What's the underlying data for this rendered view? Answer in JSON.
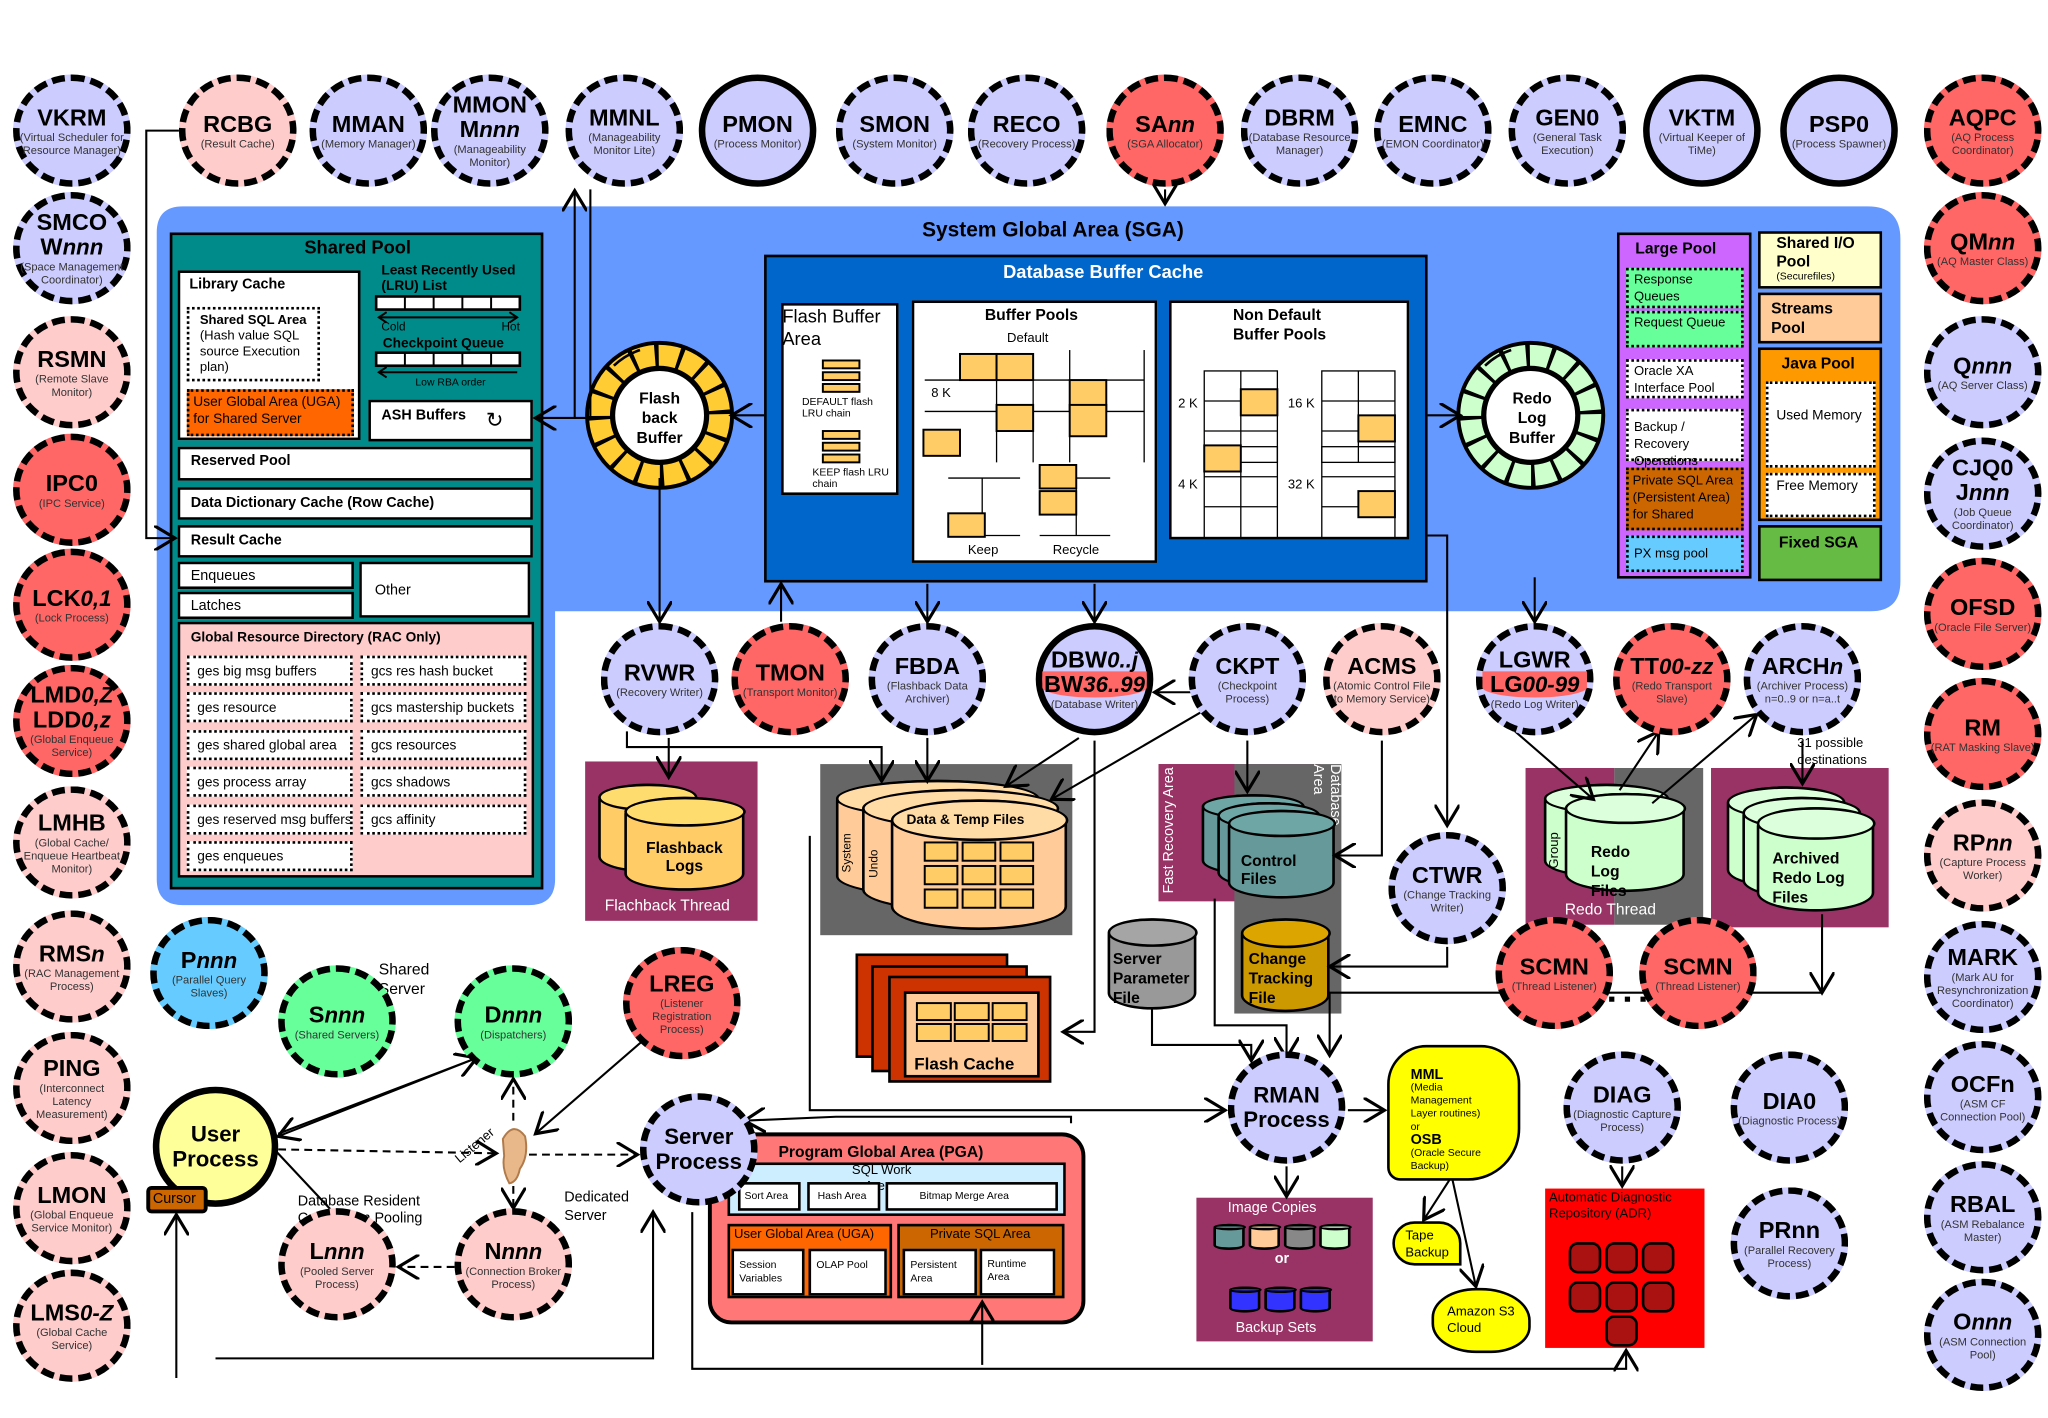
{
  "colors": {
    "lavender": "#ccccff",
    "pink": "#ffcccc",
    "red": "#ff6666",
    "green": "#66ff99",
    "blue": "#66ccff",
    "yellow": "#ffff99",
    "sga_blue": "#6699ff",
    "buffer_cache_blue": "#0066cc",
    "shared_pool_teal": "#008b8b",
    "large_pool_purple": "#cc66ff",
    "storage_purple": "#993366"
  },
  "processes": [
    {
      "id": "vkrm",
      "name": "VKRM",
      "desc": "(Virtual Scheduler for Resource Manager)",
      "fill": "lavender"
    },
    {
      "id": "rcbg",
      "name": "RCBG",
      "desc": "(Result Cache)",
      "fill": "pink"
    },
    {
      "id": "mman",
      "name": "MMAN",
      "desc": "(Memory Manager)",
      "fill": "lavender"
    },
    {
      "id": "mmon",
      "name": "MMON",
      "name2": "M",
      "name2_italic": "nnn",
      "desc": "(Manageability Monitor)",
      "fill": "lavender"
    },
    {
      "id": "mmnl",
      "name": "MMNL",
      "desc": "(Manageability Monitor Lite)",
      "fill": "lavender"
    },
    {
      "id": "pmon",
      "name": "PMON",
      "desc": "(Process Monitor)",
      "fill": "lavender",
      "solid": true
    },
    {
      "id": "smon",
      "name": "SMON",
      "desc": "(System Monitor)",
      "fill": "lavender"
    },
    {
      "id": "reco",
      "name": "RECO",
      "desc": "(Recovery Process)",
      "fill": "lavender"
    },
    {
      "id": "sann",
      "name": "SA",
      "name_italic": "nn",
      "desc": "(SGA Allocator)",
      "fill": "red"
    },
    {
      "id": "dbrm",
      "name": "DBRM",
      "desc": "(Database Resource Manager)",
      "fill": "lavender"
    },
    {
      "id": "emnc",
      "name": "EMNC",
      "desc": "(EMON Coordinator)",
      "fill": "lavender"
    },
    {
      "id": "gen0",
      "name": "GEN0",
      "desc": "(General Task Execution)",
      "fill": "lavender"
    },
    {
      "id": "vktm",
      "name": "VKTM",
      "desc": "(Virtual Keeper of TiMe)",
      "fill": "lavender",
      "solid": true
    },
    {
      "id": "psp0",
      "name": "PSP0",
      "desc": "(Process Spawner)",
      "fill": "lavender",
      "solid": true
    },
    {
      "id": "aqpc",
      "name": "AQPC",
      "desc": "(AQ Process Coordinator)",
      "fill": "red"
    },
    {
      "id": "smco",
      "name": "SMCO",
      "name2": "W",
      "name2_italic": "nnn",
      "desc": "(Space Management Coordinator)",
      "fill": "lavender"
    },
    {
      "id": "rsmn",
      "name": "RSMN",
      "desc": "(Remote Slave Monitor)",
      "fill": "pink"
    },
    {
      "id": "ipc0",
      "name": "IPC0",
      "desc": "(IPC Service)",
      "fill": "red"
    },
    {
      "id": "lck",
      "name": "LCK",
      "name_italic": "0,1",
      "desc": "(Lock Process)",
      "fill": "red"
    },
    {
      "id": "lmd",
      "name": "LMD",
      "name_italic": "0,Z",
      "name2": "LDD",
      "name2_italic": "0,z",
      "desc": "(Global Enqueue Service)",
      "fill": "red"
    },
    {
      "id": "lmhb",
      "name": "LMHB",
      "desc": "(Global Cache/ Enqueue Heartbeat Monitor)",
      "fill": "pink"
    },
    {
      "id": "rmsn",
      "name": "RMS",
      "name_italic": "n",
      "desc": "(RAC Management Process)",
      "fill": "pink"
    },
    {
      "id": "ping",
      "name": "PING",
      "desc": "(Interconnect Latency Measurement)",
      "fill": "pink"
    },
    {
      "id": "lmon",
      "name": "LMON",
      "desc": "(Global Enqueue Service Monitor)",
      "fill": "pink"
    },
    {
      "id": "lms",
      "name": "LMS",
      "name_italic": "0-Z",
      "desc": "(Global Cache Service)",
      "fill": "pink"
    },
    {
      "id": "qmnn",
      "name": "QM",
      "name_italic": "nn",
      "desc": "(AQ Master Class)",
      "fill": "red"
    },
    {
      "id": "qnnn",
      "name": "Q",
      "name_italic": "nnn",
      "desc": "(AQ Server Class)",
      "fill": "lavender"
    },
    {
      "id": "cjq0",
      "name": "CJQ0",
      "name2": "J",
      "name2_italic": "nnn",
      "desc": "(Job Queue Coordinator)",
      "fill": "lavender"
    },
    {
      "id": "ofsd",
      "name": "OFSD",
      "desc": "(Oracle File Server)",
      "fill": "red"
    },
    {
      "id": "rm",
      "name": "RM",
      "desc": "(RAT Masking Slave)",
      "fill": "red"
    },
    {
      "id": "rpnn",
      "name": "RP",
      "name_italic": "nn",
      "desc": "(Capture Process Worker)",
      "fill": "pink"
    },
    {
      "id": "mark",
      "name": "MARK",
      "desc": "(Mark AU for Resynchronization Coordinator)",
      "fill": "lavender"
    },
    {
      "id": "ocfn",
      "name": "OCFn",
      "desc": "(ASM CF Connection Pool)",
      "fill": "lavender"
    },
    {
      "id": "rbal",
      "name": "RBAL",
      "desc": "(ASM Rebalance Master)",
      "fill": "lavender"
    },
    {
      "id": "onnn",
      "name": "O",
      "name_italic": "nnn",
      "desc": "(ASM Connection Pool)",
      "fill": "lavender"
    },
    {
      "id": "rvwr",
      "name": "RVWR",
      "desc": "(Recovery Writer)",
      "fill": "lavender"
    },
    {
      "id": "tmon",
      "name": "TMON",
      "desc": "(Transport Monitor)",
      "fill": "red"
    },
    {
      "id": "fbda",
      "name": "FBDA",
      "desc": "(Flashback Data Archiver)",
      "fill": "lavender"
    },
    {
      "id": "dbw",
      "name": "DBW",
      "name_italic": "0..j",
      "band": "BW",
      "band_italic": "36..99",
      "desc": "(Database Writer)",
      "fill": "lavender",
      "solid": true
    },
    {
      "id": "ckpt",
      "name": "CKPT",
      "desc": "(Checkpoint Process)",
      "fill": "lavender"
    },
    {
      "id": "acms",
      "name": "ACMS",
      "desc": "(Atomic Control File to Memory Service)",
      "fill": "pink"
    },
    {
      "id": "lgwr",
      "name": "LGWR",
      "band": "LG",
      "band_italic": "00-99",
      "desc": "(Redo Log Writer)",
      "fill": "lavender"
    },
    {
      "id": "tt",
      "name": "TT",
      "name_italic": "00-zz",
      "desc": "(Redo Transport Slave)",
      "fill": "red"
    },
    {
      "id": "archn",
      "name": "ARCH",
      "name_italic": "n",
      "desc": "(Archiver Process) n=0..9 or n=a..t",
      "fill": "lavender"
    },
    {
      "id": "ctwr",
      "name": "CTWR",
      "desc": "(Change Tracking Writer)",
      "fill": "lavender"
    },
    {
      "id": "scmn1",
      "name": "SCMN",
      "desc": "(Thread Listener)",
      "fill": "red"
    },
    {
      "id": "scmn2",
      "name": "SCMN",
      "desc": "(Thread Listener)",
      "fill": "red"
    },
    {
      "id": "pnnn",
      "name": "P",
      "name_italic": "nnn",
      "desc": "(Parallel Query Slaves)",
      "fill": "blue"
    },
    {
      "id": "snnn",
      "name": "S",
      "name_italic": "nnn",
      "desc": "(Shared Servers)",
      "fill": "green"
    },
    {
      "id": "dnnn",
      "name": "D",
      "name_italic": "nnn",
      "desc": "(Dispatchers)",
      "fill": "green"
    },
    {
      "id": "lreg",
      "name": "LREG",
      "desc": "(Listener Registration Process)",
      "fill": "red"
    },
    {
      "id": "user",
      "name": "User",
      "name2": "Process",
      "fill": "yellow",
      "solid": true
    },
    {
      "id": "server",
      "name": "Server",
      "name2": "Process",
      "fill": "lavender"
    },
    {
      "id": "lnnn",
      "name": "L",
      "name_italic": "nnn",
      "desc": "(Pooled Server Process)",
      "fill": "pink"
    },
    {
      "id": "nnnn",
      "name": "N",
      "name_italic": "nnn",
      "desc": "(Connection Broker Process)",
      "fill": "pink"
    },
    {
      "id": "rman",
      "name": "RMAN",
      "name2": "Process",
      "fill": "lavender"
    },
    {
      "id": "diag",
      "name": "DIAG",
      "desc": "(Diagnostic Capture Process)",
      "fill": "lavender"
    },
    {
      "id": "dia0",
      "name": "DIA0",
      "desc": "(Diagnostic Process)",
      "fill": "lavender"
    },
    {
      "id": "prnn",
      "name": "PRnn",
      "desc": "(Parallel Recovery Process)",
      "fill": "lavender"
    }
  ],
  "sga": {
    "title": "System Global Area (SGA)"
  },
  "shared_pool": {
    "title": "Shared Pool",
    "library_cache": "Library Cache",
    "shared_sql_area": "Shared SQL Area",
    "shared_sql_detail": "(Hash value SQL source Execution plan)",
    "uga_shared": "User Global Area (UGA) for Shared Server",
    "lru_list": "Least Recently Used (LRU) List",
    "cold": "Cold",
    "hot": "Hot",
    "checkpoint_queue": "Checkpoint Queue",
    "low_rba": "Low RBA order",
    "ash_buffers": "ASH Buffers",
    "reserved_pool": "Reserved Pool",
    "dd_cache": "Data Dictionary Cache (Row Cache)",
    "result_cache": "Result Cache",
    "enqueues": "Enqueues",
    "latches": "Latches",
    "other": "Other",
    "grd_title": "Global Resource Directory (RAC Only)",
    "grd_left": [
      "ges big msg buffers",
      "ges resource",
      "ges shared global area",
      "ges process array",
      "ges reserved msg buffers",
      "ges enqueues"
    ],
    "grd_right": [
      "gcs res hash bucket",
      "gcs mastership buckets",
      "gcs resources",
      "gcs shadows",
      "gcs affinity"
    ]
  },
  "flashback_buffer": {
    "label": "Flash back Buffer"
  },
  "redo_log_buffer": {
    "label": "Redo Log Buffer"
  },
  "buffer_cache": {
    "title": "Database Buffer Cache",
    "flash_area": "Flash Buffer Area",
    "default_flash": "DEFAULT flash LRU chain",
    "keep_flash": "KEEP flash LRU chain",
    "buffer_pools": "Buffer  Pools",
    "default": "Default",
    "size_8k": "8 K",
    "keep": "Keep",
    "recycle": "Recycle",
    "non_default": "Non Default Buffer  Pools",
    "size_2k": "2 K",
    "size_16k": "16 K",
    "size_4k": "4 K",
    "size_32k": "32 K"
  },
  "large_pool": {
    "title": "Large Pool",
    "response_queues": "Response Queues",
    "request_queue": "Request Queue",
    "xa_pool": "Oracle XA Interface Pool",
    "backup_recovery": "Backup / Recovery Operations",
    "private_sql": "Private SQL Area (Persistent Area) for Shared servers",
    "px_msg": "PX msg pool"
  },
  "other_pools": {
    "shared_io": "Shared I/O Pool",
    "securefiles": "(Securefiles)",
    "streams": "Streams Pool",
    "java": "Java Pool",
    "used_memory": "Used Memory",
    "free_memory": "Free Memory",
    "fixed_sga": "Fixed SGA"
  },
  "storage": {
    "flashback_logs": "Flashback Logs",
    "flashback_thread": "Flachback Thread",
    "system": "System",
    "undo": "Undo",
    "data_temp": "Data & Temp Files",
    "flash_cache": "Flash Cache",
    "fast_recovery": "Fast Recovery Area",
    "database_area": "Database Area",
    "control_files": "Control Files",
    "change_tracking": "Change Tracking File",
    "spfile": "Server Parameter File",
    "group": "Group",
    "redo_log_files": "Redo Log Files",
    "redo_thread": "Redo Thread",
    "archived": "Archived Redo Log Files",
    "destinations": "31 possible destinations"
  },
  "pga": {
    "title": "Program Global Area (PGA)",
    "sql_work": "SQL Work Areas",
    "sort": "Sort Area",
    "hash": "Hash Area",
    "bitmap": "Bitmap Merge Area",
    "uga": "User Global Area (UGA)",
    "session_vars": "Session Variables",
    "olap": "OLAP Pool",
    "private_sql": "Private SQL Area",
    "persistent": "Persistent Area",
    "runtime": "Runtime Area"
  },
  "connections": {
    "shared_server": "Shared Server",
    "listener": "Listener",
    "drcp": "Database Resident Connection Pooling",
    "dedicated": "Dedicated Server",
    "cursor": "Cursor"
  },
  "backup": {
    "image_copies": "Image Copies",
    "or": "or",
    "backup_sets": "Backup Sets",
    "mml": "MML",
    "mml_desc": "(Media Management Layer routines)",
    "or2": "or",
    "osb": "OSB",
    "osb_desc": "(Oracle Secure Backup)",
    "tape": "Tape Backup",
    "s3": "Amazon S3 Cloud"
  },
  "adr": {
    "title": "Automatic Diagnostic Repository (ADR)"
  }
}
